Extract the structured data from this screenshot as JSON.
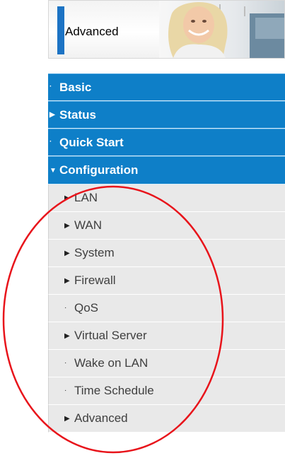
{
  "header": {
    "title": "Advanced"
  },
  "menu": {
    "top_items": [
      {
        "label": "Basic",
        "marker": "·"
      },
      {
        "label": "Status",
        "marker": "▶"
      },
      {
        "label": "Quick Start",
        "marker": "·"
      },
      {
        "label": "Configuration",
        "marker": "▼"
      }
    ],
    "sub_items": [
      {
        "label": "LAN",
        "marker": "▶"
      },
      {
        "label": "WAN",
        "marker": "▶"
      },
      {
        "label": "System",
        "marker": "▶"
      },
      {
        "label": "Firewall",
        "marker": "▶"
      },
      {
        "label": "QoS",
        "marker": "·"
      },
      {
        "label": "Virtual Server",
        "marker": "▶"
      },
      {
        "label": "Wake on LAN",
        "marker": "·"
      },
      {
        "label": "Time Schedule",
        "marker": "·"
      },
      {
        "label": "Advanced",
        "marker": "▶"
      }
    ]
  },
  "colors": {
    "menu_blue": "#0e7fc8",
    "submenu_gray": "#e9e9e9",
    "accent_bar": "#1c73c4",
    "annotation_red": "#e8141b"
  }
}
